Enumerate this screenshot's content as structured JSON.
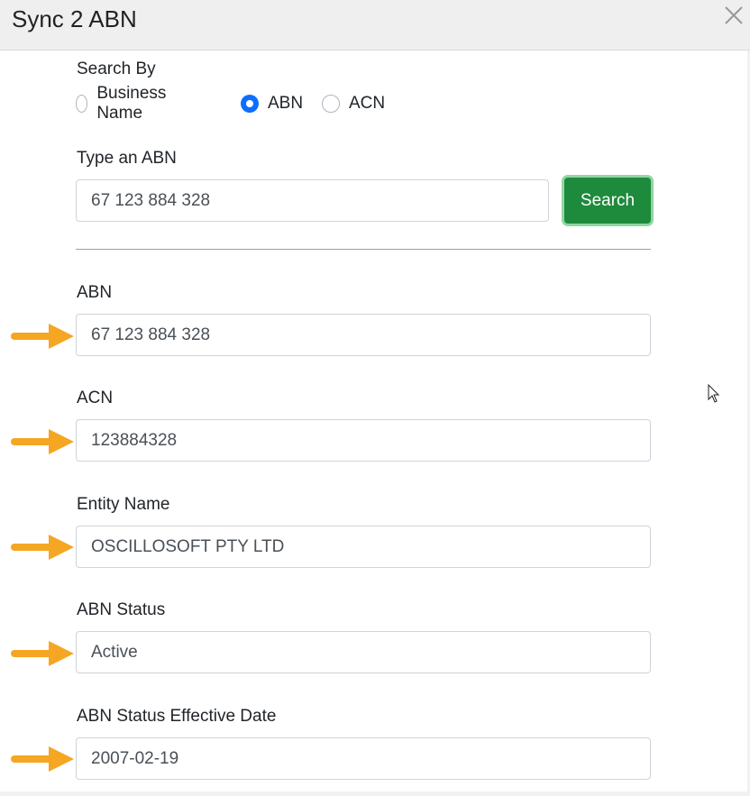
{
  "dialog": {
    "title": "Sync 2 ABN"
  },
  "search_by": {
    "label": "Search By",
    "options": [
      {
        "label": "Business Name",
        "checked": false
      },
      {
        "label": "ABN",
        "checked": true
      },
      {
        "label": "ACN",
        "checked": false
      }
    ]
  },
  "query": {
    "label": "Type an ABN",
    "value": "67 123 884 328",
    "button_label": "Search"
  },
  "results": {
    "abn": {
      "label": "ABN",
      "value": "67 123 884 328"
    },
    "acn": {
      "label": "ACN",
      "value": "123884328"
    },
    "entity_name": {
      "label": "Entity Name",
      "value": "OSCILLOSOFT PTY LTD"
    },
    "abn_status": {
      "label": "ABN Status",
      "value": "Active"
    },
    "abn_status_effective_date": {
      "label": "ABN Status Effective Date",
      "value": "2007-02-19"
    }
  },
  "colors": {
    "primary_button": "#1e8a3c",
    "radio_checked": "#0d6efd",
    "arrow": "#f5a623"
  },
  "icons": {
    "close": "close-icon",
    "arrow": "arrow-right-icon",
    "cursor": "mouse-pointer-icon"
  }
}
